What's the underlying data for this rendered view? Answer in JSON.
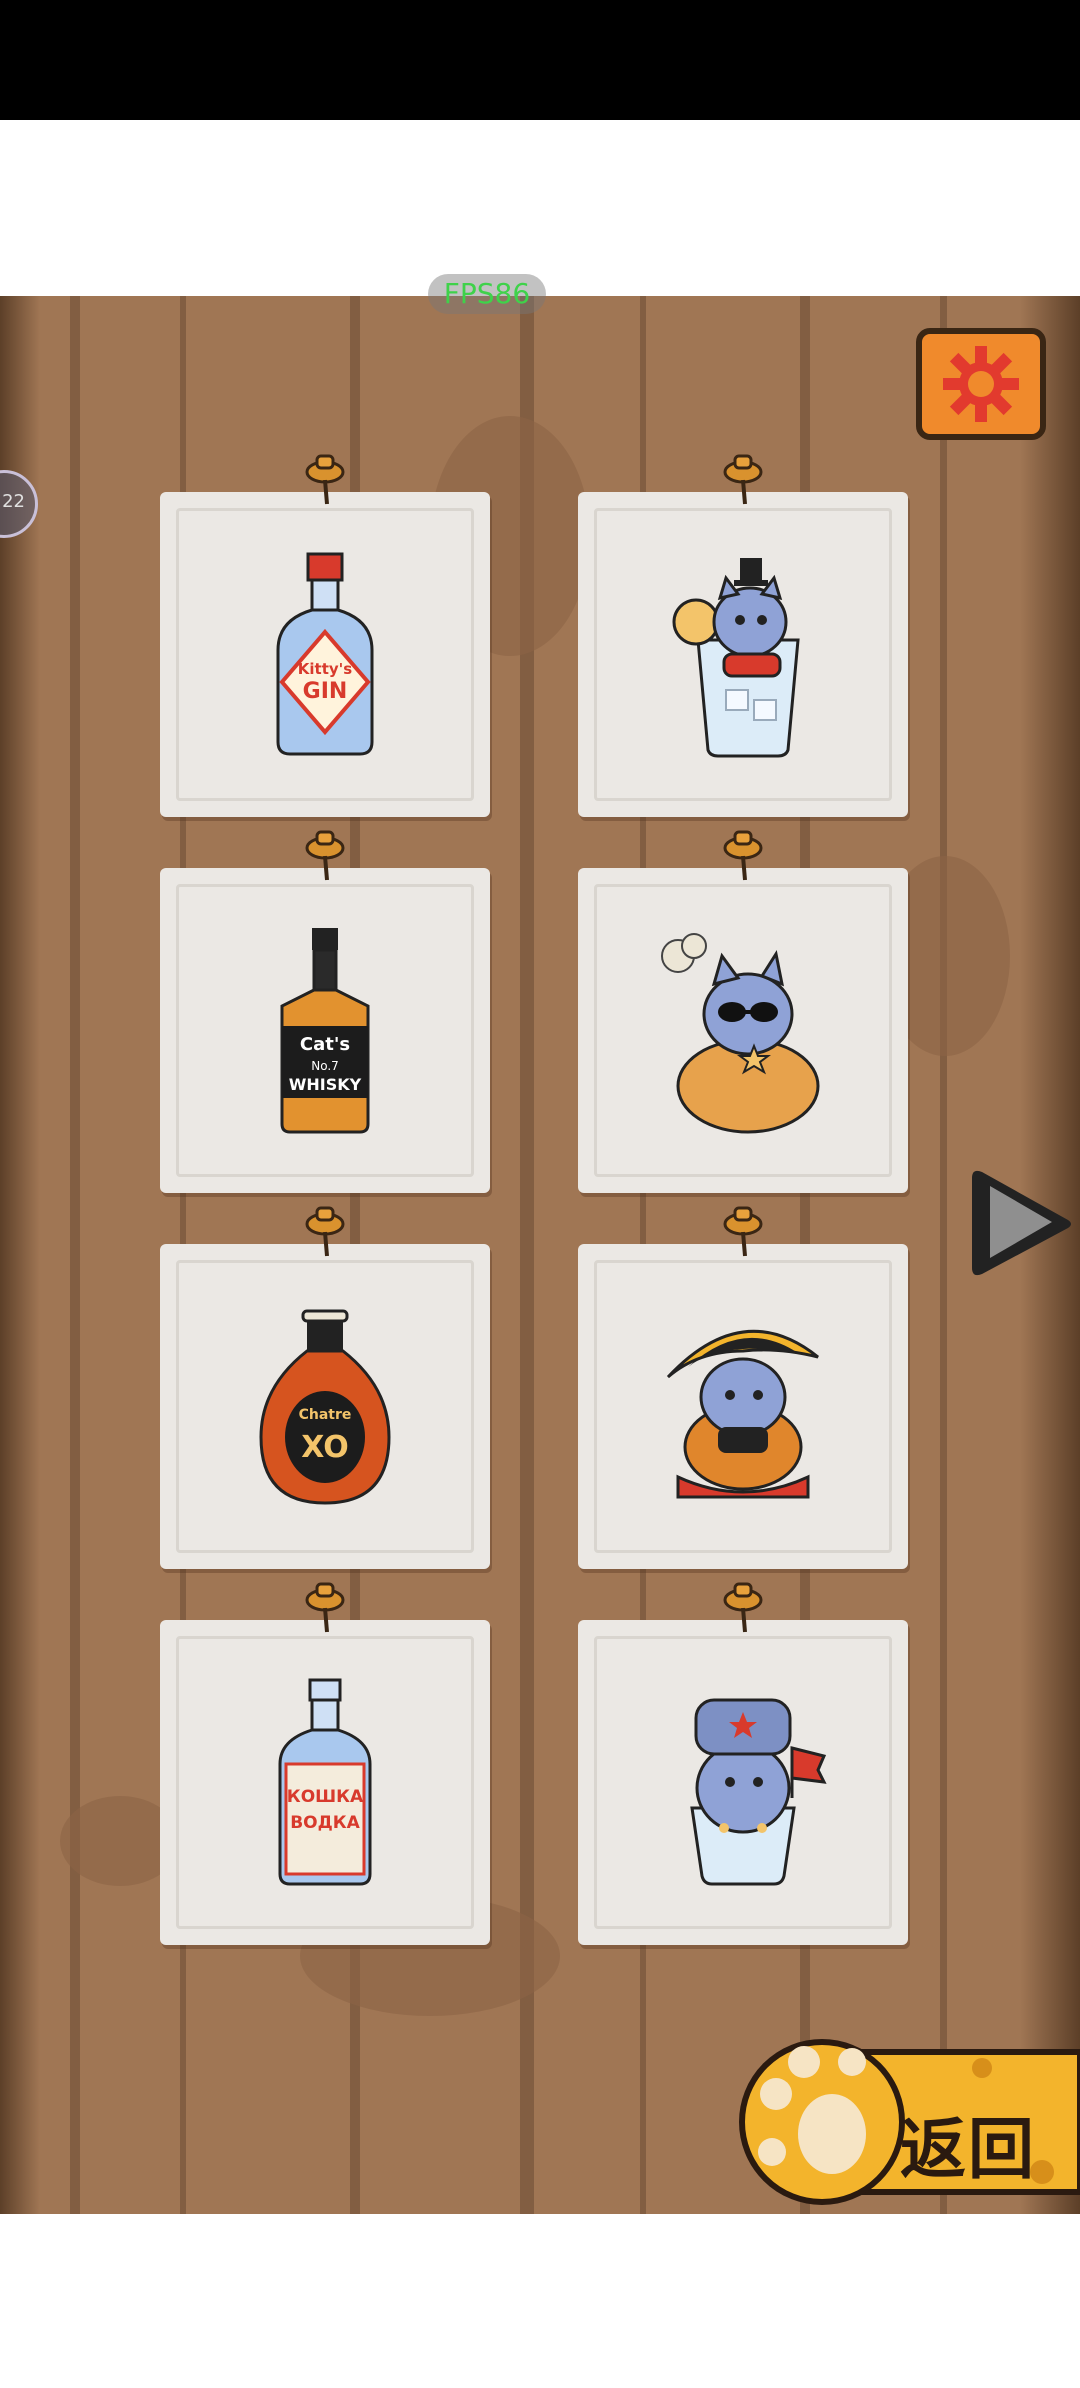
{
  "fps_label": "FPS86",
  "side_bubble_text": "22",
  "back_button": {
    "label": "返回"
  },
  "collection": [
    {
      "name": "kittys-gin",
      "label_lines": [
        "Kitty's",
        "GIN"
      ],
      "kind": "bottle"
    },
    {
      "name": "gin-cat-glass",
      "label_lines": [],
      "kind": "cat"
    },
    {
      "name": "cats-whisky",
      "label_lines": [
        "Cat's",
        "No.7",
        "WHISKY"
      ],
      "kind": "bottle"
    },
    {
      "name": "whisky-cowboy-cat",
      "label_lines": [],
      "kind": "cat"
    },
    {
      "name": "chatre-xo",
      "label_lines": [
        "Chatre",
        "XO"
      ],
      "kind": "bottle"
    },
    {
      "name": "cognac-napoleon-cat",
      "label_lines": [],
      "kind": "cat"
    },
    {
      "name": "koshka-vodka",
      "label_lines": [
        "КОШКА",
        "ВОДКА"
      ],
      "kind": "bottle"
    },
    {
      "name": "vodka-ushanka-cat",
      "label_lines": [],
      "kind": "cat"
    }
  ],
  "colors": {
    "board": "#a07654",
    "card": "#ebe8e4",
    "accent_orange": "#f08a2c",
    "cat_blue": "#8fa2d6"
  }
}
